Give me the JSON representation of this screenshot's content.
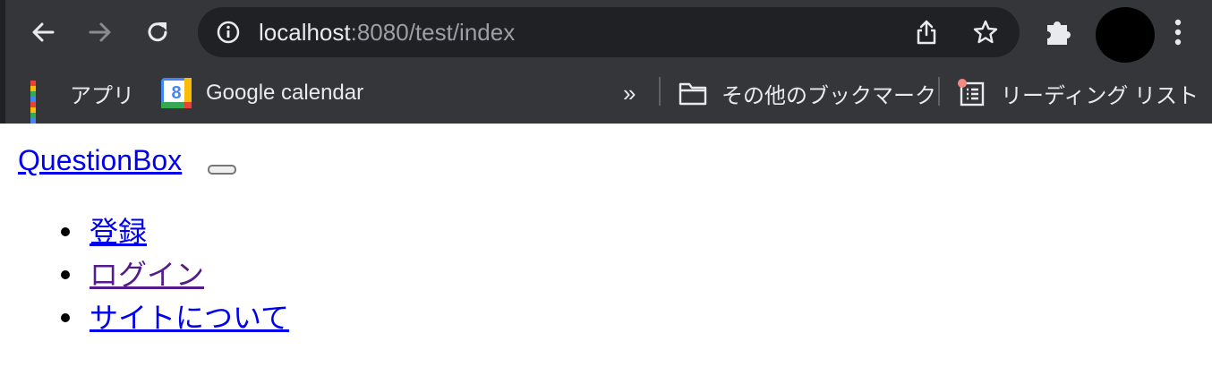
{
  "browser": {
    "url_host": "localhost",
    "url_rest": ":8080/test/index",
    "icons": {
      "back": "arrow-left-icon",
      "forward": "arrow-right-icon",
      "reload": "reload-icon",
      "info": "info-icon",
      "share": "share-icon",
      "bookmark": "star-icon",
      "extensions": "puzzle-icon",
      "menu": "kebab-menu-icon"
    },
    "colors": {
      "frame": "#35363a",
      "omnibox": "#202124",
      "text": "#e8eaed",
      "muted": "#9aa0a6",
      "reading_list_dot": "#f28b82"
    }
  },
  "bookmarks_bar": {
    "apps_label": "アプリ",
    "items": [
      {
        "label": "Google calendar",
        "icon": "google-calendar-icon",
        "icon_text": "8"
      }
    ],
    "overflow_label": "»",
    "other_bookmarks_label": "その他のブックマーク",
    "reading_list_label": "リーディング リスト"
  },
  "page": {
    "brand": "QuestionBox",
    "nav": {
      "items": [
        {
          "label": "登録"
        },
        {
          "label": "ログイン"
        },
        {
          "label": "サイトについて"
        }
      ]
    },
    "colors": {
      "link": "#0000ee",
      "visited_link": "#551a8b"
    }
  }
}
